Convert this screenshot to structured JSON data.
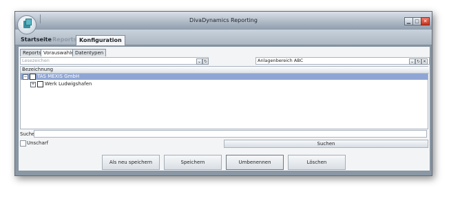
{
  "window": {
    "title": "DivaDynamics Reporting",
    "minimize_glyph": "▁",
    "maximize_glyph": "□",
    "close_glyph": "✕"
  },
  "ribbon": {
    "tabs": [
      {
        "label": "Startseite"
      },
      {
        "label": "Reports"
      },
      {
        "label": "Konfiguration"
      }
    ],
    "active_tab": "Konfiguration"
  },
  "subtabs": [
    {
      "label": "Reports"
    },
    {
      "label": "Vorauswahlen"
    },
    {
      "label": "Datentypen"
    }
  ],
  "bookmark_combo": {
    "placeholder": "Lesezeichen"
  },
  "area_combo": {
    "value": "Anlagenbereich ABC"
  },
  "tree": {
    "header": "Bezeichnung",
    "rows": [
      {
        "label": "TAS MEXIS GmbH",
        "expander": "−",
        "selected": true
      },
      {
        "label": "Werk Ludwigshafen",
        "expander": "+",
        "selected": false
      }
    ]
  },
  "search": {
    "label": "Suche:",
    "value": "",
    "fuzzy_label": "Unscharf",
    "button_label": "Suchen"
  },
  "actions": {
    "save_as_new": "Als neu speichern",
    "save": "Speichern",
    "rename": "Umbenennen",
    "delete": "Löschen"
  },
  "icons": {
    "dropdown": "chevron-down-icon",
    "refresh": "refresh-icon",
    "clear": "close-icon"
  },
  "colors": {
    "selection": "#8fa6d4",
    "frame": "#8a97a5"
  }
}
